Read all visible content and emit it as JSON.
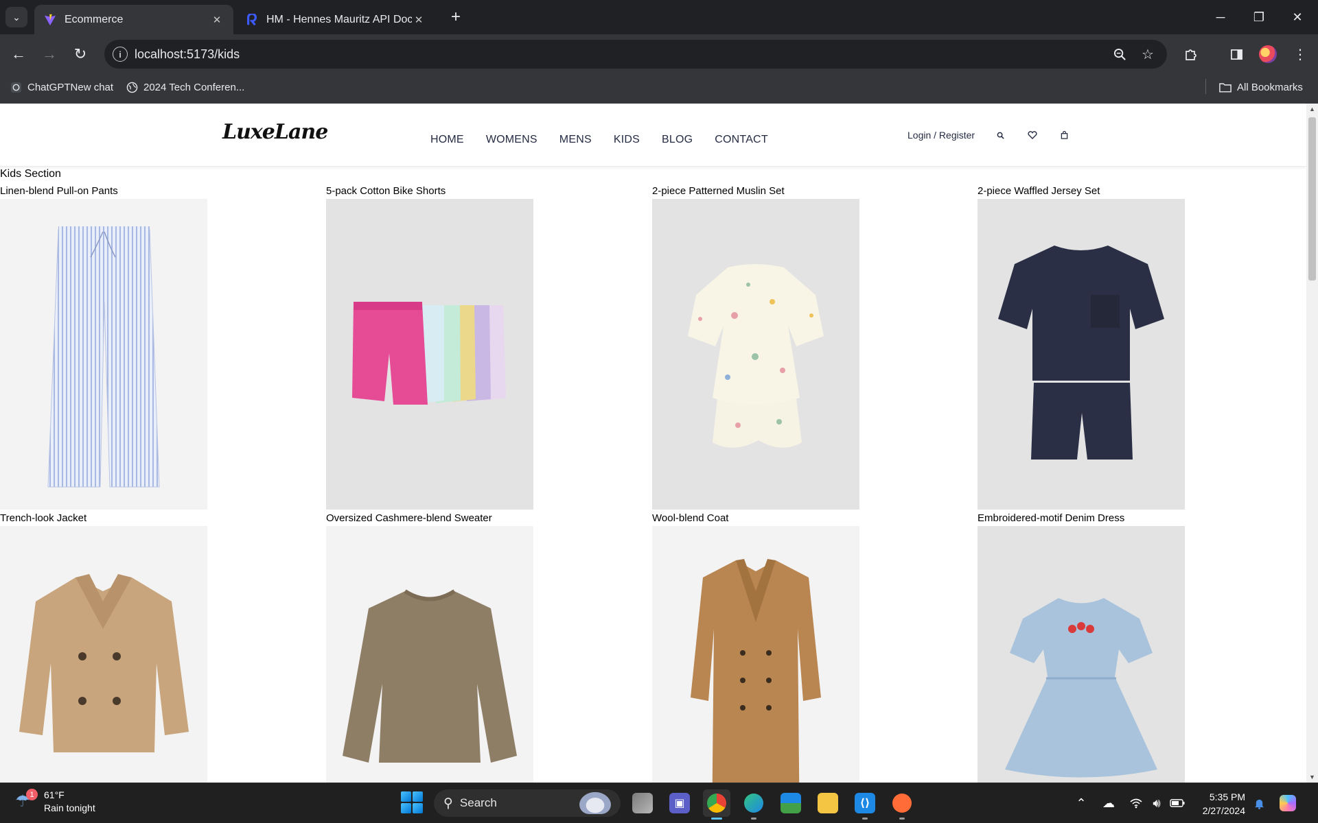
{
  "browser": {
    "tabs": [
      {
        "title": "Ecommerce",
        "active": true,
        "favicon": "vite-icon"
      },
      {
        "title": "HM - Hennes Mauritz API Docu",
        "active": false,
        "favicon": "rapidapi-icon"
      }
    ],
    "url": "localhost:5173/kids",
    "bookmarks": [
      {
        "label": "ChatGPTNew chat",
        "icon": "chatgpt-icon"
      },
      {
        "label": "2024 Tech Conferen...",
        "icon": "globe-icon"
      }
    ],
    "all_bookmarks_label": "All Bookmarks"
  },
  "site": {
    "logo": "LuxeLane",
    "nav": [
      "HOME",
      "WOMENS",
      "MENS",
      "KIDS",
      "BLOG",
      "CONTACT"
    ],
    "login_label": "Login / Register",
    "section_title": "Kids Section",
    "products": [
      {
        "name": "Linen-blend Pull-on Pants",
        "image": "striped-pants",
        "bg": "#f3f3f3"
      },
      {
        "name": "5-pack Cotton Bike Shorts",
        "image": "bike-shorts",
        "bg": "#e3e3e3"
      },
      {
        "name": "2-piece Patterned Muslin Set",
        "image": "floral-set",
        "bg": "#e3e3e3"
      },
      {
        "name": "2-piece Waffled Jersey Set",
        "image": "navy-set",
        "bg": "#e3e3e3"
      },
      {
        "name": "Trench-look Jacket",
        "image": "trench-jacket",
        "bg": "#f3f3f3"
      },
      {
        "name": "Oversized Cashmere-blend Sweater",
        "image": "sweater",
        "bg": "#f3f3f3"
      },
      {
        "name": "Wool-blend Coat",
        "image": "wool-coat",
        "bg": "#f3f3f3"
      },
      {
        "name": "Embroidered-motif Denim Dress",
        "image": "denim-dress",
        "bg": "#e3e3e3"
      }
    ]
  },
  "taskbar": {
    "weather_temp": "61°F",
    "weather_desc": "Rain tonight",
    "weather_badge": "1",
    "search_label": "Search",
    "time": "5:35 PM",
    "date": "2/27/2024"
  }
}
